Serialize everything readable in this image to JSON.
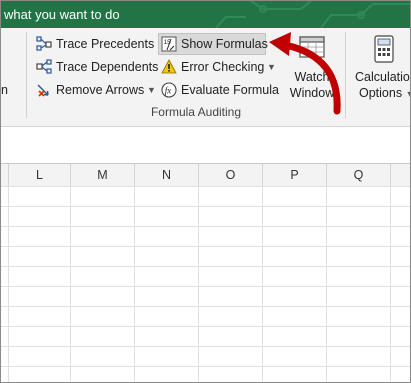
{
  "titlebar": {
    "search_text": "what you want to do"
  },
  "ribbon": {
    "left_cut_label": "n",
    "trace_precedents": "Trace Precedents",
    "trace_dependents": "Trace Dependents",
    "remove_arrows": "Remove Arrows",
    "show_formulas": "Show Formulas",
    "error_checking": "Error Checking",
    "evaluate_formula": "Evaluate Formula",
    "watch_window_line1": "Watch",
    "watch_window_line2": "Window",
    "calc_options_line1": "Calculation",
    "calc_options_line2": "Options",
    "group_label": "Formula Auditing"
  },
  "columns": [
    "L",
    "M",
    "N",
    "O",
    "P",
    "Q"
  ],
  "colors": {
    "excel_green": "#227447",
    "annotation_red": "#c00000"
  }
}
